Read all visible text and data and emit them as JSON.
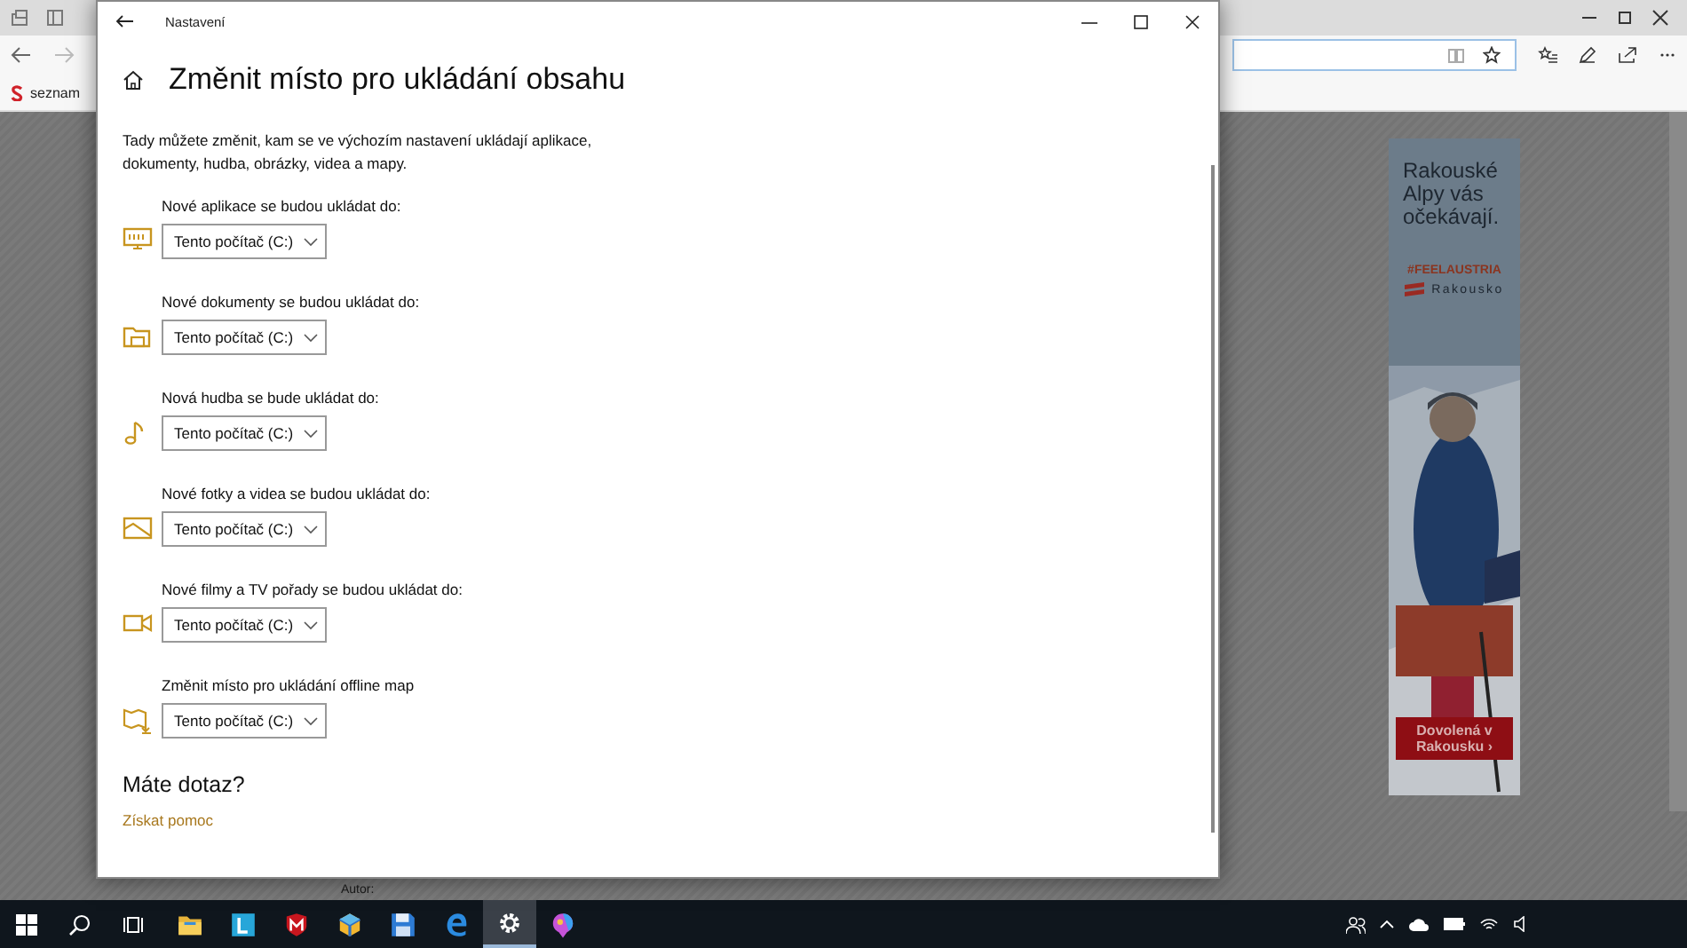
{
  "browser": {
    "bookmarks": [
      {
        "label": "seznam"
      }
    ],
    "page_text": "Autor:"
  },
  "ad": {
    "headline": "Rakouské Alpy vás očekávají.",
    "hashtag": "#FEELAUSTRIA",
    "brand": "Rakousko",
    "button": "Dovolená v Rakousku ›"
  },
  "window": {
    "title": "Nastavení"
  },
  "page": {
    "heading": "Změnit místo pro ukládání obsahu",
    "description": "Tady můžete změnit, kam se ve výchozím nastavení ukládají aplikace, dokumenty, hudba, obrázky, videa a mapy.",
    "settings": [
      {
        "kind": "apps",
        "label": "Nové aplikace se budou ukládat do:",
        "value": "Tento počítač (C:)"
      },
      {
        "kind": "documents",
        "label": "Nové dokumenty se budou ukládat do:",
        "value": "Tento počítač (C:)"
      },
      {
        "kind": "music",
        "label": "Nová hudba se bude ukládat do:",
        "value": "Tento počítač (C:)"
      },
      {
        "kind": "photos",
        "label": "Nové fotky a videa se budou ukládat do:",
        "value": "Tento počítač (C:)"
      },
      {
        "kind": "movies",
        "label": "Nové filmy a TV pořady se budou ukládat do:",
        "value": "Tento počítač (C:)"
      },
      {
        "kind": "maps",
        "label": "Změnit místo pro ukládání offline map",
        "value": "Tento počítač (C:)"
      }
    ],
    "help": {
      "heading": "Máte dotaz?",
      "link": "Získat pomoc"
    }
  },
  "taskbar": {
    "apps": [
      {
        "kind": "explorer",
        "selected": false
      },
      {
        "kind": "letter",
        "selected": false
      },
      {
        "kind": "shield",
        "selected": false
      },
      {
        "kind": "cube",
        "selected": false
      },
      {
        "kind": "floppy",
        "selected": false
      },
      {
        "kind": "edge",
        "selected": false
      },
      {
        "kind": "settings",
        "selected": true
      },
      {
        "kind": "paint",
        "selected": false
      }
    ]
  }
}
